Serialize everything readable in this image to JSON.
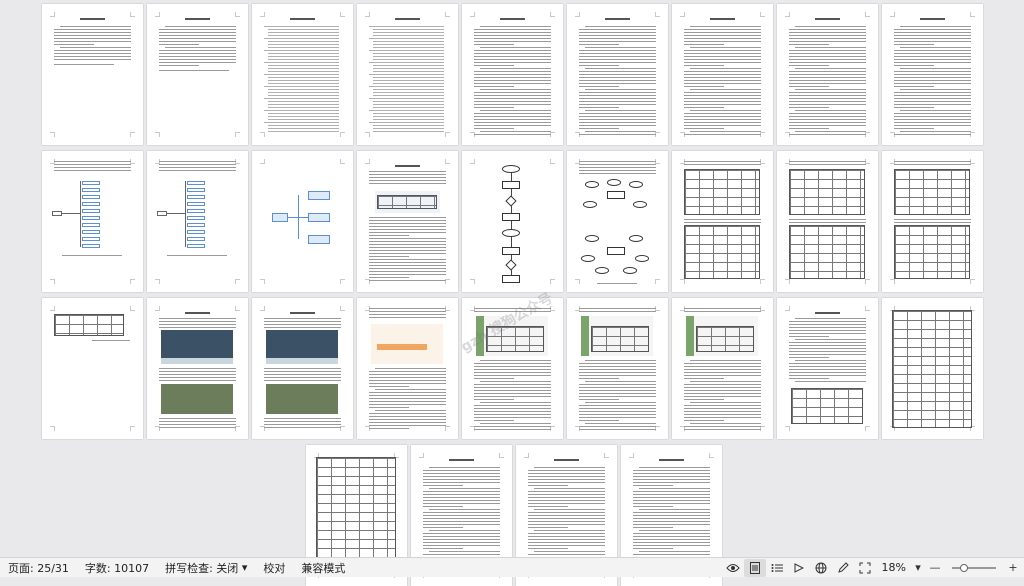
{
  "status_bar": {
    "page": "页面: 25/31",
    "words": "字数: 10107",
    "spell_check": "拼写检查: 关闭",
    "proofread": "校对",
    "compat_mode": "兼容模式",
    "zoom": "18%",
    "zoom_level_fraction": 0.18
  },
  "watermark": "gzh 搜狗公众号",
  "pages": [
    {
      "id": 1,
      "kind": "abstract-cn",
      "heading": "摘  要"
    },
    {
      "id": 2,
      "kind": "abstract-en",
      "heading": "Abstract"
    },
    {
      "id": 3,
      "kind": "toc",
      "heading": "目  录"
    },
    {
      "id": 4,
      "kind": "toc"
    },
    {
      "id": 5,
      "kind": "text",
      "heading": "一 绪论"
    },
    {
      "id": 6,
      "kind": "text"
    },
    {
      "id": 7,
      "kind": "text",
      "heading": "二 相关技术介绍"
    },
    {
      "id": 8,
      "kind": "text"
    },
    {
      "id": 9,
      "kind": "text",
      "heading": "三 需求分析"
    },
    {
      "id": 10,
      "kind": "tree"
    },
    {
      "id": 11,
      "kind": "tree"
    },
    {
      "id": 12,
      "kind": "mindmap",
      "nodes": [
        "用户",
        "管理员",
        "系统"
      ]
    },
    {
      "id": 13,
      "kind": "arch",
      "heading": "四 系统设计"
    },
    {
      "id": 14,
      "kind": "flowchart"
    },
    {
      "id": 15,
      "kind": "er"
    },
    {
      "id": 16,
      "kind": "tables"
    },
    {
      "id": 17,
      "kind": "tables"
    },
    {
      "id": 18,
      "kind": "tables"
    },
    {
      "id": 19,
      "kind": "small-table"
    },
    {
      "id": 20,
      "kind": "screens",
      "heading": "五 系统实现"
    },
    {
      "id": 21,
      "kind": "screens"
    },
    {
      "id": 22,
      "kind": "chart-screen"
    },
    {
      "id": 23,
      "kind": "screen"
    },
    {
      "id": 24,
      "kind": "screen"
    },
    {
      "id": 25,
      "kind": "screen"
    },
    {
      "id": 26,
      "kind": "test",
      "heading": "六 系统测试"
    },
    {
      "id": 27,
      "kind": "test-table"
    },
    {
      "id": 28,
      "kind": "test-table"
    },
    {
      "id": 29,
      "kind": "text",
      "heading": "结  论"
    },
    {
      "id": 30,
      "kind": "text",
      "heading": "参考文献"
    },
    {
      "id": 31,
      "kind": "text",
      "heading": "致  谢"
    }
  ]
}
